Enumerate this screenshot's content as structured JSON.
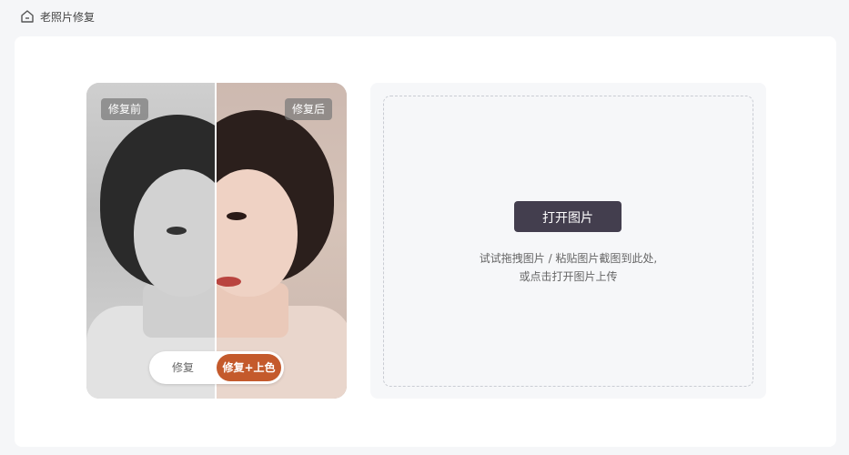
{
  "header": {
    "title": "老照片修复",
    "icon": "home-icon"
  },
  "preview": {
    "before_label": "修复前",
    "after_label": "修复后",
    "toggle": {
      "option_plain": "修复",
      "option_color": "修复+上色",
      "selected": "修复+上色"
    },
    "accent_color": "#c45a2c"
  },
  "upload": {
    "button_label": "打开图片",
    "hint_line1": "试试拖拽图片 / 粘贴图片截图到此处,",
    "hint_line2": "或点击打开图片上传",
    "button_color": "#433e4e"
  }
}
